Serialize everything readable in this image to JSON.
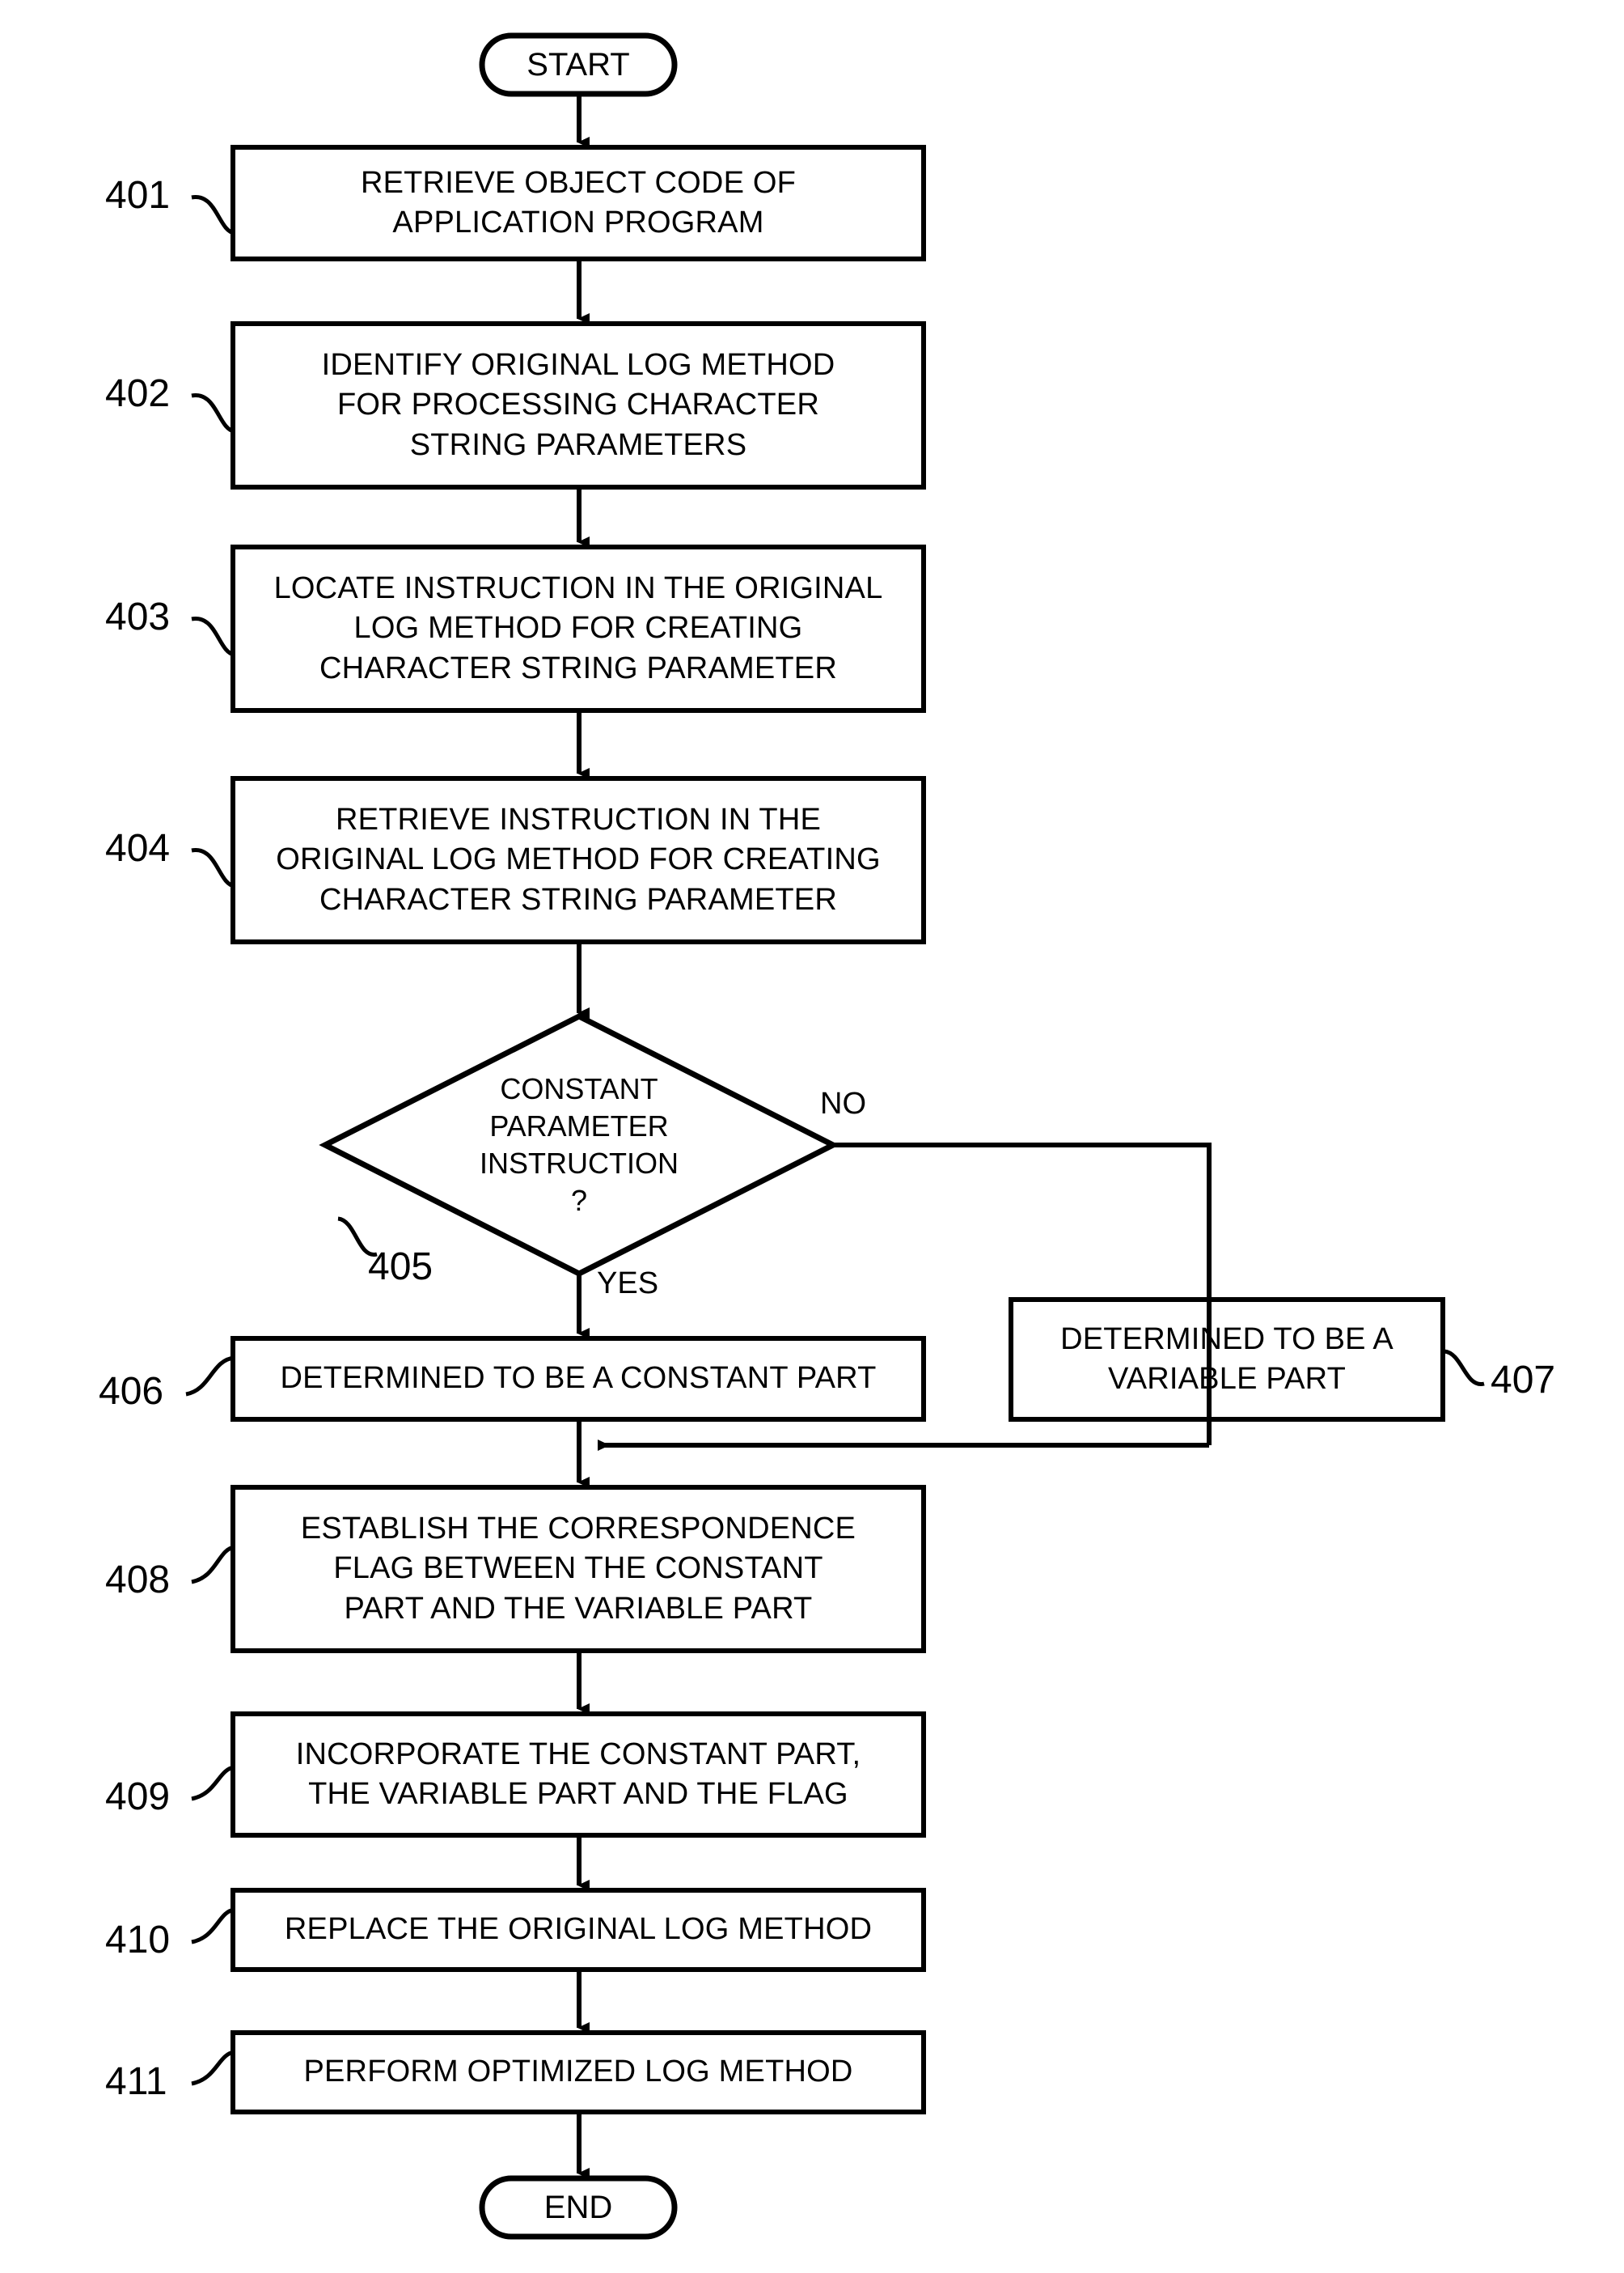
{
  "figure": {
    "type": "flowchart",
    "orientation": "vertical",
    "line_color": "#000000",
    "background_color": "#ffffff"
  },
  "terminators": {
    "start": "START",
    "end": "END"
  },
  "steps": [
    {
      "ref": "401",
      "text": "RETRIEVE OBJECT CODE OF\nAPPLICATION PROGRAM"
    },
    {
      "ref": "402",
      "text": "IDENTIFY ORIGINAL LOG METHOD\nFOR PROCESSING CHARACTER\nSTRING PARAMETERS"
    },
    {
      "ref": "403",
      "text": "LOCATE INSTRUCTION IN THE ORIGINAL\nLOG METHOD FOR CREATING\nCHARACTER STRING PARAMETER"
    },
    {
      "ref": "404",
      "text": "RETRIEVE INSTRUCTION IN THE\nORIGINAL LOG METHOD FOR CREATING\nCHARACTER STRING PARAMETER"
    },
    {
      "ref": "405",
      "text": "CONSTANT\nPARAMETER\nINSTRUCTION\n?"
    },
    {
      "ref": "406",
      "text": "DETERMINED TO BE A CONSTANT PART"
    },
    {
      "ref": "407",
      "text": "DETERMINED TO BE A\nVARIABLE PART"
    },
    {
      "ref": "408",
      "text": "ESTABLISH THE CORRESPONDENCE\nFLAG BETWEEN THE CONSTANT\nPART AND THE VARIABLE PART"
    },
    {
      "ref": "409",
      "text": "INCORPORATE THE CONSTANT PART,\nTHE VARIABLE PART AND THE FLAG"
    },
    {
      "ref": "410",
      "text": "REPLACE THE ORIGINAL LOG METHOD"
    },
    {
      "ref": "411",
      "text": "PERFORM OPTIMIZED LOG METHOD"
    }
  ],
  "decision": {
    "ref": "405",
    "question": "CONSTANT\nPARAMETER\nINSTRUCTION\n?",
    "yes_label": "YES",
    "no_label": "NO",
    "yes_target_ref": "406",
    "no_target_ref": "407"
  },
  "edge_labels": {
    "yes": "YES",
    "no": "NO"
  }
}
